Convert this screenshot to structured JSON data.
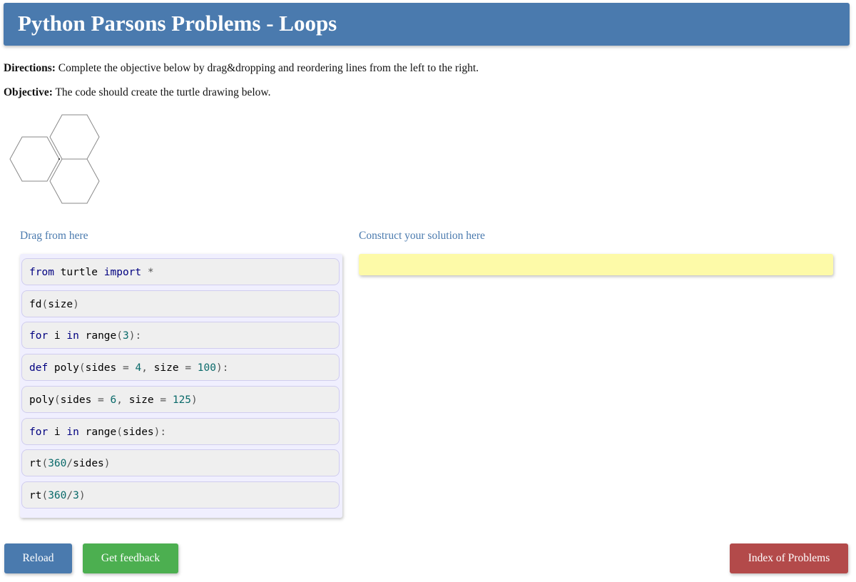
{
  "header": {
    "title": "Python Parsons Problems - Loops"
  },
  "directions": {
    "label": "Directions:",
    "text": " Complete the objective below by drag&dropping and reordering lines from the left to the right."
  },
  "objective": {
    "label": "Objective:",
    "text": " The code should create the turtle drawing below."
  },
  "drawing": {
    "description_icon": "hexagon-turtle-drawing",
    "stroke": "#888888"
  },
  "source": {
    "label": "Drag from here"
  },
  "target": {
    "label": "Construct your solution here"
  },
  "code_blocks": [
    [
      {
        "t": "from",
        "c": "kw"
      },
      {
        "t": " turtle ",
        "c": ""
      },
      {
        "t": "import",
        "c": "kw"
      },
      {
        "t": " *",
        "c": "op"
      }
    ],
    [
      {
        "t": "fd",
        "c": ""
      },
      {
        "t": "(",
        "c": "op"
      },
      {
        "t": "size",
        "c": ""
      },
      {
        "t": ")",
        "c": "op"
      }
    ],
    [
      {
        "t": "for",
        "c": "kw"
      },
      {
        "t": " i ",
        "c": ""
      },
      {
        "t": "in",
        "c": "kw"
      },
      {
        "t": " range",
        "c": ""
      },
      {
        "t": "(",
        "c": "op"
      },
      {
        "t": "3",
        "c": "num"
      },
      {
        "t": "):",
        "c": "op"
      }
    ],
    [
      {
        "t": "def",
        "c": "kw"
      },
      {
        "t": " poly",
        "c": ""
      },
      {
        "t": "(",
        "c": "op"
      },
      {
        "t": "sides ",
        "c": ""
      },
      {
        "t": "=",
        "c": "op"
      },
      {
        "t": " ",
        "c": ""
      },
      {
        "t": "4",
        "c": "num"
      },
      {
        "t": ",",
        "c": "op"
      },
      {
        "t": " size ",
        "c": ""
      },
      {
        "t": "=",
        "c": "op"
      },
      {
        "t": " ",
        "c": ""
      },
      {
        "t": "100",
        "c": "num"
      },
      {
        "t": "):",
        "c": "op"
      }
    ],
    [
      {
        "t": "poly",
        "c": ""
      },
      {
        "t": "(",
        "c": "op"
      },
      {
        "t": "sides ",
        "c": ""
      },
      {
        "t": "=",
        "c": "op"
      },
      {
        "t": " ",
        "c": ""
      },
      {
        "t": "6",
        "c": "num"
      },
      {
        "t": ",",
        "c": "op"
      },
      {
        "t": " size ",
        "c": ""
      },
      {
        "t": "=",
        "c": "op"
      },
      {
        "t": " ",
        "c": ""
      },
      {
        "t": "125",
        "c": "num"
      },
      {
        "t": ")",
        "c": "op"
      }
    ],
    [
      {
        "t": "for",
        "c": "kw"
      },
      {
        "t": " i ",
        "c": ""
      },
      {
        "t": "in",
        "c": "kw"
      },
      {
        "t": " range",
        "c": ""
      },
      {
        "t": "(",
        "c": "op"
      },
      {
        "t": "sides",
        "c": ""
      },
      {
        "t": "):",
        "c": "op"
      }
    ],
    [
      {
        "t": "rt",
        "c": ""
      },
      {
        "t": "(",
        "c": "op"
      },
      {
        "t": "360",
        "c": "num"
      },
      {
        "t": "/",
        "c": "op"
      },
      {
        "t": "sides",
        "c": ""
      },
      {
        "t": ")",
        "c": "op"
      }
    ],
    [
      {
        "t": "rt",
        "c": ""
      },
      {
        "t": "(",
        "c": "op"
      },
      {
        "t": "360",
        "c": "num"
      },
      {
        "t": "/",
        "c": "op"
      },
      {
        "t": "3",
        "c": "num"
      },
      {
        "t": ")",
        "c": "op"
      }
    ]
  ],
  "buttons": {
    "reload": "Reload",
    "feedback": "Get feedback",
    "index": "Index of Problems"
  },
  "colors": {
    "header": "#4a7aae",
    "reload": "#4a7aae",
    "feedback": "#4caf50",
    "index": "#b34a4a",
    "target_bg": "#fdfaa8",
    "source_bg": "#f0effe"
  }
}
